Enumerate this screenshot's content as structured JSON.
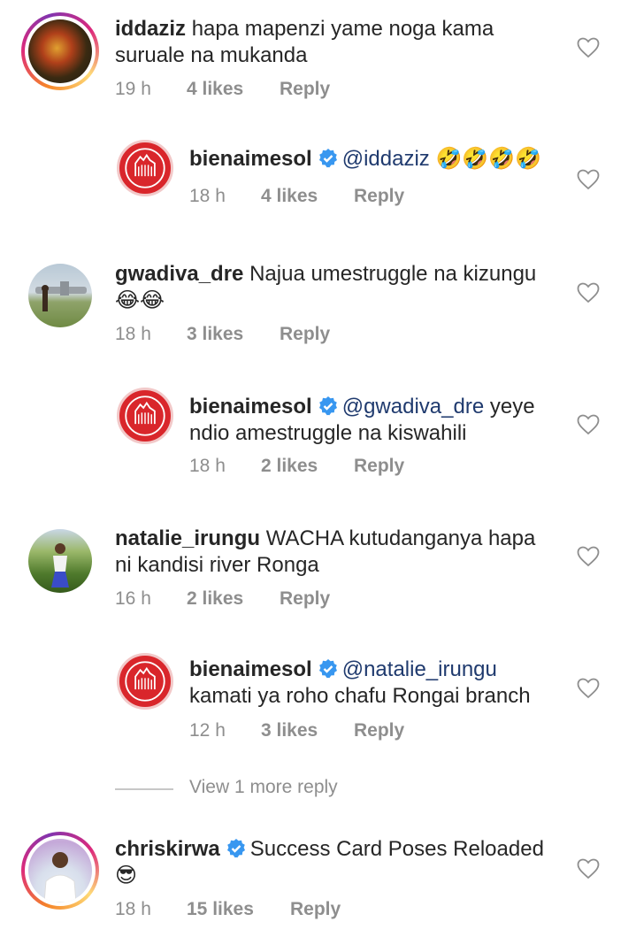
{
  "colors": {
    "mention": "#1f3a6e",
    "meta": "#8e8e8e",
    "verified": "#3897f0",
    "brand_red": "#d9262b"
  },
  "comments": [
    {
      "username": "iddaziz",
      "text": "hapa mapenzi yame noga kama",
      "text2": "suruale na mukanda",
      "time": "19 h",
      "likes": "4 likes",
      "reply": "Reply",
      "verified": false,
      "avatar_icon": "story-avatar"
    },
    {
      "username": "bienaimesol",
      "mention": "@iddaziz",
      "text": "",
      "emoji": "🤣🤣🤣🤣",
      "time": "18 h",
      "likes": "4 likes",
      "reply": "Reply",
      "verified": true,
      "avatar_icon": "rooster-logo"
    },
    {
      "username": "gwadiva_dre",
      "text": "Najua umestruggle na kizungu",
      "emoji": "😂😂",
      "time": "18 h",
      "likes": "3 likes",
      "reply": "Reply",
      "verified": false,
      "avatar_icon": "photo-avatar"
    },
    {
      "username": "bienaimesol",
      "mention": "@gwadiva_dre",
      "text": " yeye",
      "text2": "ndio amestruggle na kiswahili",
      "time": "18 h",
      "likes": "2 likes",
      "reply": "Reply",
      "verified": true,
      "avatar_icon": "rooster-logo"
    },
    {
      "username": "natalie_irungu",
      "text": "WACHA kutudanganya hapa",
      "text2": "ni kandisi river Ronga",
      "time": "16 h",
      "likes": "2 likes",
      "reply": "Reply",
      "verified": false,
      "avatar_icon": "photo-avatar"
    },
    {
      "username": "bienaimesol",
      "mention": "@natalie_irungu",
      "text2": "kamati ya roho chafu Rongai branch",
      "time": "12 h",
      "likes": "3 likes",
      "reply": "Reply",
      "verified": true,
      "avatar_icon": "rooster-logo"
    },
    {
      "username": "chriskirwa",
      "text": "Success Card Poses Reloaded",
      "emoji": "😎",
      "time": "18 h",
      "likes": "15 likes",
      "reply": "Reply",
      "verified": true,
      "avatar_icon": "story-avatar"
    }
  ],
  "view_more": "View 1 more reply"
}
